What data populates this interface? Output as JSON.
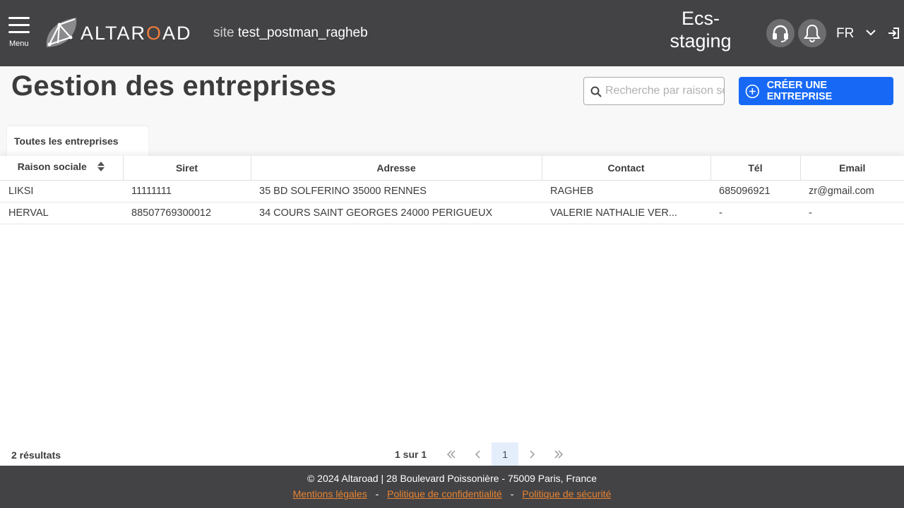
{
  "header": {
    "menu_label": "Menu",
    "logo_text_before": "ALTAR",
    "logo_text_o": "O",
    "logo_text_after": "AD",
    "site_word": "site",
    "site_name": "test_postman_ragheb",
    "env_line1": "Ecs-",
    "env_line2": "staging",
    "support_icon": "headset-icon",
    "notification_icon": "bell-icon",
    "language": "FR"
  },
  "page": {
    "title": "Gestion des entreprises",
    "search_placeholder": "Recherche par raison sociale",
    "create_button": "CRÉER UNE ENTREPRISE",
    "tab_label": "Toutes les entreprises"
  },
  "table": {
    "columns": [
      "Raison sociale",
      "Siret",
      "Adresse",
      "Contact",
      "Tél",
      "Email"
    ],
    "rows": [
      [
        "LIKSI",
        "11111111",
        "35 BD SOLFERINO 35000 RENNES",
        "RAGHEB",
        "685096921",
        "zr@gmail.com"
      ],
      [
        "HERVAL",
        "88507769300012",
        "34 COURS SAINT GEORGES 24000 PERIGUEUX",
        "VALERIE NATHALIE VER...",
        "-",
        "-"
      ]
    ]
  },
  "pagination": {
    "results": "2 résultats",
    "page_info": "1 sur 1",
    "current_page": "1"
  },
  "footer": {
    "copyright": "© 2024 Altaroad | 28 Boulevard Poissonière - 75009 Paris, France",
    "links": [
      "Mentions légales",
      "Politique de confidentialité",
      "Politique de sécurité"
    ],
    "separator": "-"
  },
  "colors": {
    "header_bg": "#434346",
    "accent_blue": "#1769f5",
    "accent_orange": "#f07d3c",
    "link_orange": "#e8832f"
  }
}
